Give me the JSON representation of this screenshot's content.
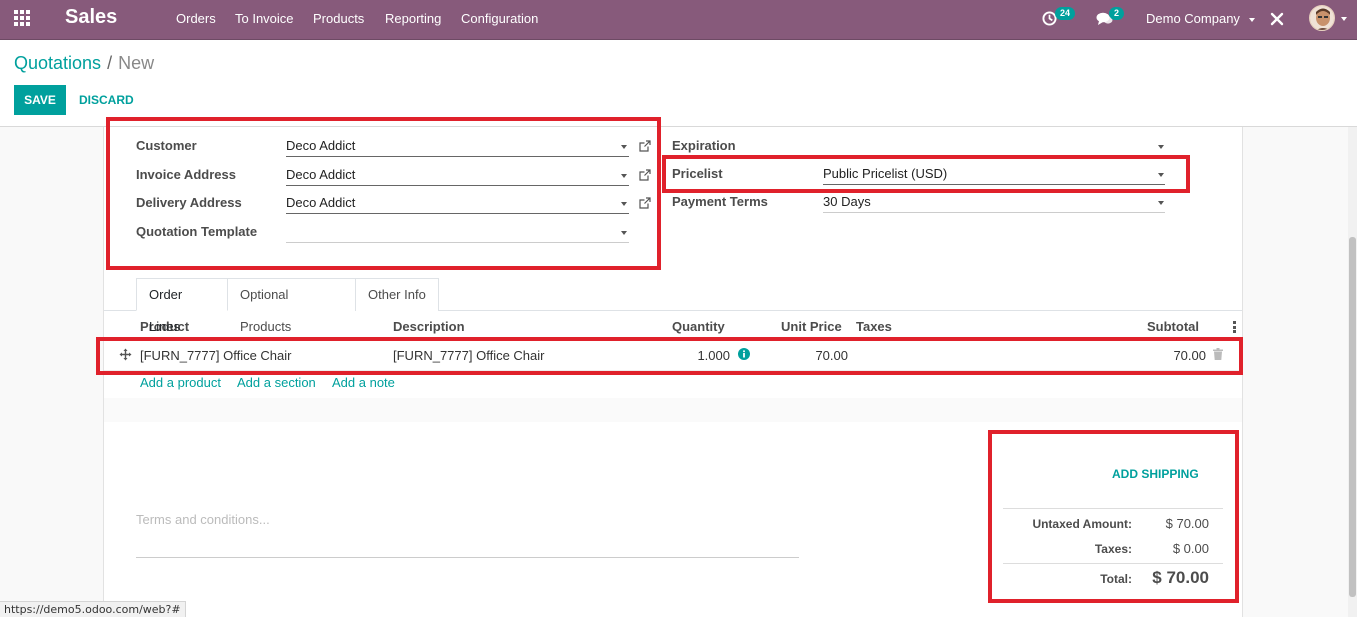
{
  "navbar": {
    "app_title": "Sales",
    "menu": [
      "Orders",
      "To Invoice",
      "Products",
      "Reporting",
      "Configuration"
    ],
    "activity_count": "24",
    "message_count": "2",
    "company": "Demo Company",
    "color": "#875a7b"
  },
  "control": {
    "breadcrumb_parent": "Quotations",
    "breadcrumb_sep": "/",
    "breadcrumb_current": "New",
    "save_label": "SAVE",
    "discard_label": "DISCARD",
    "accent": "#00a09d"
  },
  "form": {
    "left": [
      {
        "label": "Customer",
        "value": "Deco Addict"
      },
      {
        "label": "Invoice Address",
        "value": "Deco Addict"
      },
      {
        "label": "Delivery Address",
        "value": "Deco Addict"
      },
      {
        "label": "Quotation Template",
        "value": ""
      }
    ],
    "right": [
      {
        "label": "Expiration",
        "value": ""
      },
      {
        "label": "Pricelist",
        "value": "Public Pricelist (USD)"
      },
      {
        "label": "Payment Terms",
        "value": "30 Days"
      }
    ]
  },
  "tabs": [
    "Order Lines",
    "Optional Products",
    "Other Info"
  ],
  "order_lines": {
    "headers": {
      "product": "Product",
      "description": "Description",
      "quantity": "Quantity",
      "unit_price": "Unit Price",
      "taxes": "Taxes",
      "subtotal": "Subtotal"
    },
    "rows": [
      {
        "product": "[FURN_7777] Office Chair",
        "description": "[FURN_7777] Office Chair",
        "quantity": "1.000",
        "unit_price": "70.00",
        "taxes": "",
        "subtotal": "70.00"
      }
    ],
    "add_product": "Add a product",
    "add_section": "Add a section",
    "add_note": "Add a note"
  },
  "terms_placeholder": "Terms and conditions...",
  "totals": {
    "add_shipping": "ADD SHIPPING",
    "untaxed_label": "Untaxed Amount:",
    "untaxed_value": "$ 70.00",
    "taxes_label": "Taxes:",
    "taxes_value": "$ 0.00",
    "total_label": "Total:",
    "total_value": "$ 70.00"
  },
  "status_url": "https://demo5.odoo.com/web?#",
  "highlight_color": "#e0212b"
}
